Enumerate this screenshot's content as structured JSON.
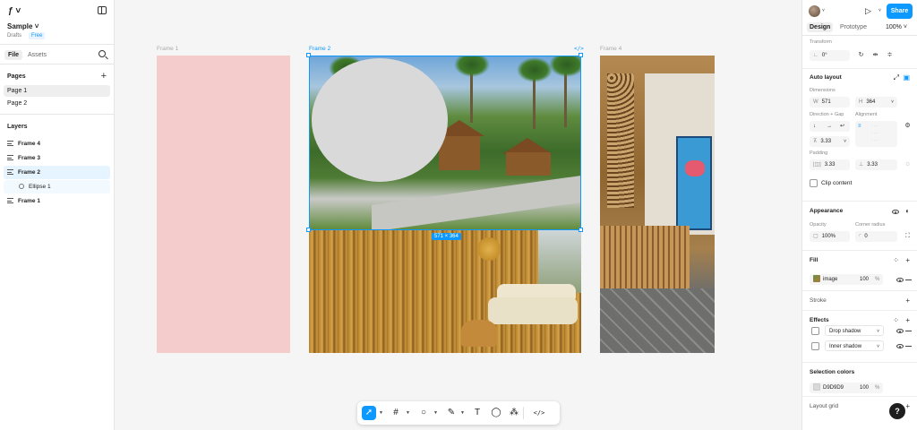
{
  "left_panel": {
    "file_name": "Sample",
    "drafts_label": "Drafts",
    "plan_badge": "Free",
    "tabs": [
      "File",
      "Assets"
    ],
    "pages_title": "Pages",
    "pages": [
      {
        "label": "Page 1",
        "selected": true
      },
      {
        "label": "Page 2",
        "selected": false
      }
    ],
    "layers_title": "Layers",
    "layers": [
      {
        "label": "Frame 4"
      },
      {
        "label": "Frame 3"
      },
      {
        "label": "Frame 2",
        "selected": true
      },
      {
        "label": "Ellipse 1",
        "child": true
      },
      {
        "label": "Frame 1"
      }
    ]
  },
  "canvas": {
    "frame_labels": [
      "Frame 1",
      "Frame 2",
      "Frame 4"
    ],
    "selection_size": "571 × 364",
    "code_icon": "</>"
  },
  "toolbar": {
    "tools": [
      "move-tool",
      "frame-tool",
      "shape-tool",
      "pen-tool",
      "text-tool",
      "comment-tool",
      "actions-tool",
      "dev-mode-toggle"
    ]
  },
  "right_panel": {
    "share_label": "Share",
    "tabs": [
      "Design",
      "Prototype"
    ],
    "zoom": "100%",
    "transform": {
      "title": "Transform",
      "rotation": "0°"
    },
    "auto_layout": {
      "title": "Auto layout",
      "dimensions_label": "Dimensions",
      "w_prefix": "W",
      "w_value": "571",
      "h_prefix": "H",
      "h_value": "364",
      "direction_gap_label": "Direction + Gap",
      "alignment_label": "Alignment",
      "gap_value": "3.33",
      "padding_label": "Padding",
      "padding_h": "3.33",
      "padding_v": "3.33",
      "clip_content": "Clip content"
    },
    "appearance": {
      "title": "Appearance",
      "opacity_label": "Opacity",
      "opacity_value": "100%",
      "radius_label": "Corner radius",
      "radius_value": "0"
    },
    "fill": {
      "title": "Fill",
      "type": "image",
      "opacity": "100",
      "unit": "%"
    },
    "stroke": {
      "title": "Stroke"
    },
    "effects": {
      "title": "Effects",
      "items": [
        "Drop shadow",
        "Inner shadow"
      ]
    },
    "selection_colors": {
      "title": "Selection colors",
      "color_hex": "D9D9D9",
      "opacity": "100",
      "unit": "%",
      "swatch": "#d9d9d9"
    },
    "layout_grid": {
      "title": "Layout grid"
    },
    "help": "?"
  },
  "colors": {
    "accent": "#0d99ff",
    "frame1_fill": "#f5cccc",
    "ellipse_fill": "#d9d9d9"
  }
}
